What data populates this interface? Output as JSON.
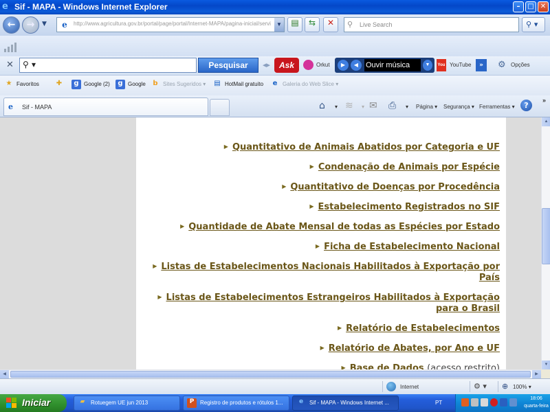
{
  "window": {
    "title": "Sif - MAPA - Windows Internet Explorer",
    "min_glyph": "–",
    "max_glyph": "□",
    "close_glyph": "✕"
  },
  "address_bar": {
    "url": "http://www.agricultura.gov.br/portal/page/portal/Internet-MAPA/pagina-inicial/servi",
    "search_placeholder": "Live Search"
  },
  "ask_toolbar": {
    "search_button": "Pesquisar",
    "ask_logo": "Ask",
    "orkut_label": "Orkut",
    "music_label": "Ouvir música",
    "youtube_label": "YouTube",
    "options_label": "Opções"
  },
  "favorites_bar": {
    "favorites_label": "Favoritos",
    "items": [
      {
        "label": "Google (2)"
      },
      {
        "label": "Google"
      },
      {
        "label": "Sites Sugeridos ▾"
      },
      {
        "label": "HotMail gratuito"
      },
      {
        "label": "Galeria do Web Slice ▾"
      }
    ]
  },
  "tabs": [
    {
      "label": "Sif - MAPA"
    }
  ],
  "command_bar": {
    "page_label": "Página",
    "security_label": "Segurança",
    "tools_label": "Ferramentas"
  },
  "content": {
    "links": [
      {
        "label": "Quantitativo de Animais Abatidos por Categoria e UF"
      },
      {
        "label": "Condenação de Animais por Espécie"
      },
      {
        "label": "Quantitativo de Doenças por Procedência"
      },
      {
        "label": "Estabelecimento Registrados no SIF"
      },
      {
        "label": "Quantidade de Abate Mensal de todas as Espécies por Estado"
      },
      {
        "label": "Ficha de Estabelecimento Nacional"
      },
      {
        "label": "Listas de Estabelecimentos Nacionais Habilitados à Exportação por País"
      },
      {
        "label": "Listas de Estabelecimentos Estrangeiros Habilitados à Exportação para o Brasil"
      },
      {
        "label": "Relatório de Estabelecimentos"
      },
      {
        "label": "Relatório de Abates, por Ano e UF"
      },
      {
        "label": "Base de Dados",
        "note": "(acesso restrito)"
      }
    ]
  },
  "status_bar": {
    "zone": "Internet",
    "zoom": "100%"
  },
  "taskbar": {
    "start_label": "Iniciar",
    "tasks": [
      {
        "label": "Rotuegem UE jun 2013"
      },
      {
        "label": "Registro de produtos e rótulos 1..."
      },
      {
        "label": "Sif - MAPA - Windows Internet ..."
      }
    ],
    "language": "PT",
    "time": "18:06",
    "day": "quarta-feira"
  },
  "colors": {
    "link": "#6a5618",
    "titlebar": "#0447c8",
    "taskbar": "#245edb",
    "start": "#2f8f2c"
  }
}
